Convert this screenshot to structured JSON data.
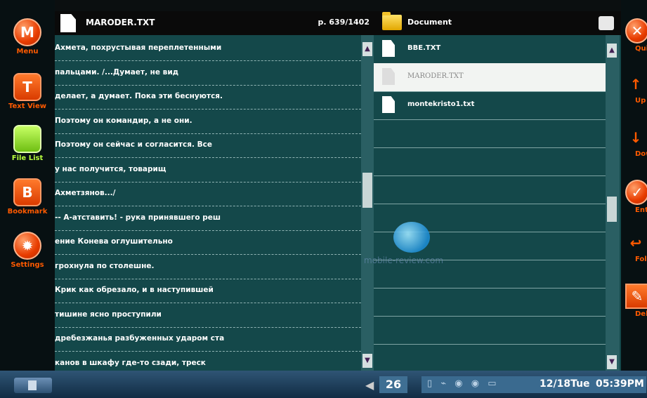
{
  "left_menu": [
    {
      "glyph": "M",
      "label": "Menu"
    },
    {
      "glyph": "T",
      "label": "Text View"
    },
    {
      "glyph": "",
      "label": "File List"
    },
    {
      "glyph": "B",
      "label": "Bookmark"
    },
    {
      "glyph": "✹",
      "label": "Settings"
    }
  ],
  "right_menu": [
    {
      "glyph": "✕",
      "label": "Quit"
    },
    {
      "glyph": "↑",
      "label": "Up"
    },
    {
      "glyph": "↓",
      "label": "Down"
    },
    {
      "glyph": "✓",
      "label": "Enter"
    },
    {
      "glyph": "↩",
      "label": "Folder"
    },
    {
      "glyph": "✎",
      "label": "Delete"
    }
  ],
  "reader": {
    "file_name": "MARODER.TXT",
    "page_indicator": "p. 639/1402",
    "lines": [
      "    Ахмета, похрустывая переплетенными",
      "пальцами. /...Думает, не вид",
      "    делает, а думает. Пока эти беснуются.",
      "Поэтому он командир, а не они.",
      "    Поэтому он сейчас и согласится. Все",
      "у нас получится, товарищ",
      "    Ахметзянов.../",
      "      -- А-атставить! - рука принявшего реш",
      "ение Конева оглушительно",
      "    грохнула по столешне.",
      "      Крик как обрезало, и в наступившей",
      "тишине ясно проступили",
      "    дребезжанья разбуженных ударом ста",
      "канов в шкафу где-то сзади, треск"
    ]
  },
  "files": {
    "folder_name": "Document",
    "items": [
      {
        "name": "BBE.TXT",
        "selected": false
      },
      {
        "name": "MARODER.TXT",
        "selected": true
      },
      {
        "name": "montekristo1.txt",
        "selected": false
      }
    ]
  },
  "watermark": "mobile-review.com",
  "taskbar": {
    "count": "26",
    "date": "12/18Tue",
    "time": "05:39PM"
  }
}
